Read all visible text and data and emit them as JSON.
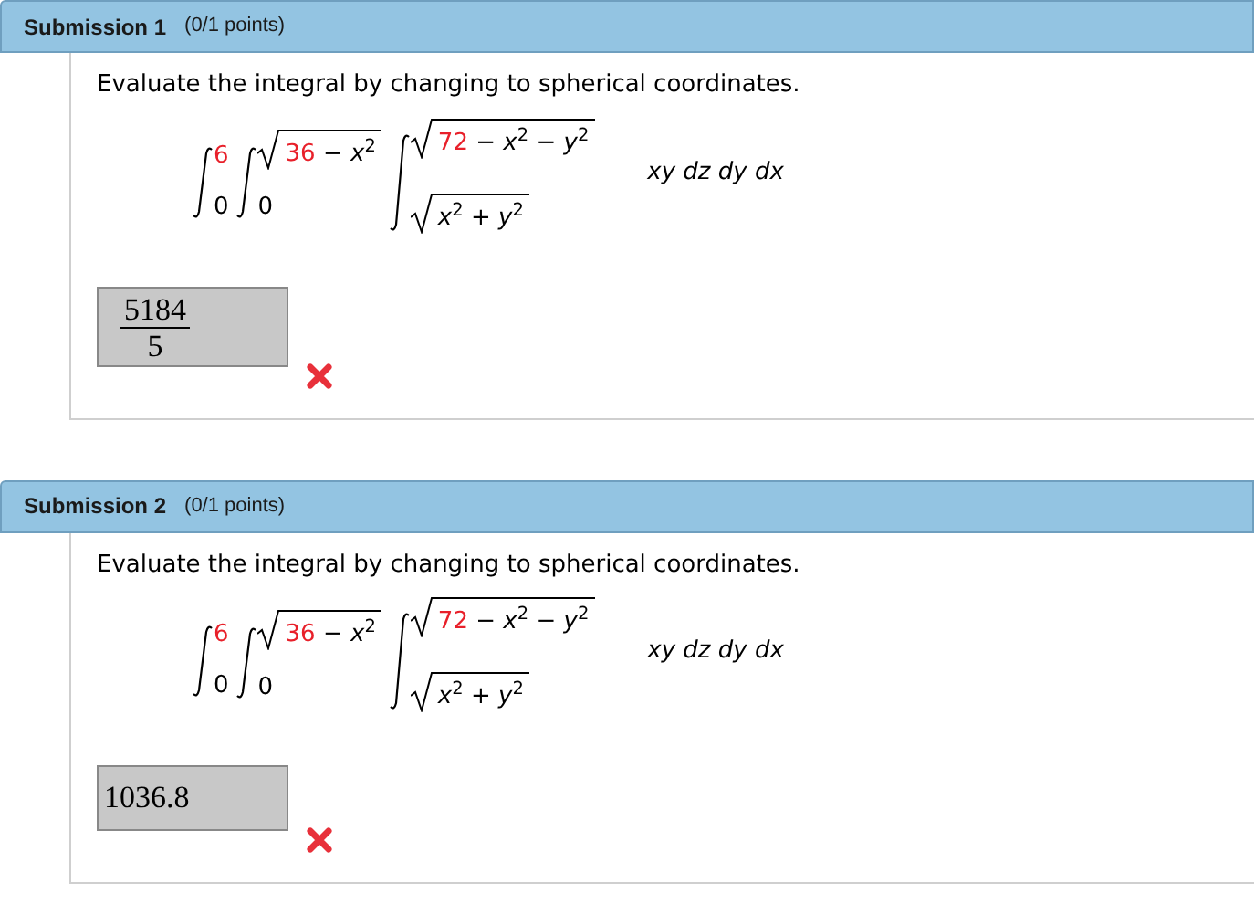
{
  "submissions": [
    {
      "title": "Submission 1",
      "points": "(0/1 points)",
      "prompt": "Evaluate the integral by changing to spherical coordinates.",
      "integrals": [
        {
          "upper": [
            {
              "text": "6",
              "highlighted": true
            }
          ],
          "upper_radical": false,
          "lower": [
            {
              "text": "0",
              "highlighted": false
            }
          ],
          "lower_radical": false
        },
        {
          "upper": [
            {
              "text": "36",
              "highlighted": true
            },
            {
              "text": " − *x*$^{2}$",
              "highlighted": false
            }
          ],
          "upper_radical": true,
          "lower": [
            {
              "text": "0",
              "highlighted": false
            }
          ],
          "lower_radical": false
        },
        {
          "upper": [
            {
              "text": "72",
              "highlighted": true
            },
            {
              "text": " − *x*$^{2}$ − *y*$^{2}$",
              "highlighted": false
            }
          ],
          "upper_radical": true,
          "lower": [
            {
              "text": "*x*$^{2}$ + *y*$^{2}$",
              "highlighted": false
            }
          ],
          "lower_radical": true
        }
      ],
      "integrand": "xy dz dy dx",
      "answer": {
        "kind": "fraction",
        "numerator": "5184",
        "denominator": "5"
      },
      "correct": false
    },
    {
      "title": "Submission 2",
      "points": "(0/1 points)",
      "prompt": "Evaluate the integral by changing to spherical coordinates.",
      "integrals": [
        {
          "upper": [
            {
              "text": "6",
              "highlighted": true
            }
          ],
          "upper_radical": false,
          "lower": [
            {
              "text": "0",
              "highlighted": false
            }
          ],
          "lower_radical": false
        },
        {
          "upper": [
            {
              "text": "36",
              "highlighted": true
            },
            {
              "text": " − *x*$^{2}$",
              "highlighted": false
            }
          ],
          "upper_radical": true,
          "lower": [
            {
              "text": "0",
              "highlighted": false
            }
          ],
          "lower_radical": false
        },
        {
          "upper": [
            {
              "text": "72",
              "highlighted": true
            },
            {
              "text": " − *x*$^{2}$ − *y*$^{2}$",
              "highlighted": false
            }
          ],
          "upper_radical": true,
          "lower": [
            {
              "text": "*x*$^{2}$ + *y*$^{2}$",
              "highlighted": false
            }
          ],
          "lower_radical": true
        }
      ],
      "integrand": "xy dz dy dx",
      "answer": {
        "kind": "number",
        "value": "1036.8"
      },
      "correct": false
    }
  ]
}
